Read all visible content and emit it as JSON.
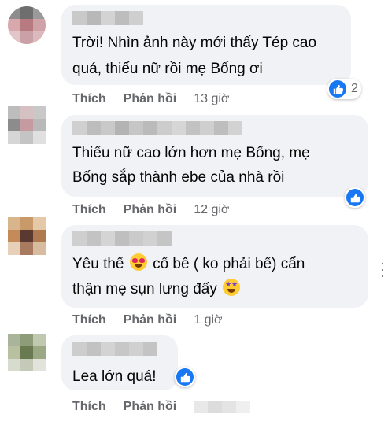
{
  "colors": {
    "like_blue": "#1877f2",
    "bubble_bg": "#f0f2f5",
    "text": "#050505",
    "muted": "#65676b"
  },
  "comments": [
    {
      "text_lines": [
        "Trời! Nhìn ảnh này mới thấy Tép cao",
        "quá, thiếu nữ rồi mẹ Bống ơi"
      ],
      "reaction": {
        "icon": "like-icon",
        "count": "2"
      },
      "actions": {
        "like": "Thích",
        "reply": "Phản hồi",
        "time": "13 giờ"
      }
    },
    {
      "text_lines": [
        "Thiếu nữ cao lớn hơn mẹ Bống, mẹ",
        "Bống sắp thành ebe của nhà rồi"
      ],
      "reaction": {
        "icon": "like-icon",
        "count": ""
      },
      "actions": {
        "like": "Thích",
        "reply": "Phản hồi",
        "time": "12 giờ"
      }
    },
    {
      "text_lines": [
        "Yêu thế",
        "cố bê ( ko phải bế) cẩn",
        "thận mẹ sụn lưng đấy"
      ],
      "emojis": [
        "heart-eyes-emoji",
        "star-struck-emoji"
      ],
      "actions": {
        "like": "Thích",
        "reply": "Phản hồi",
        "time": "1 giờ"
      }
    },
    {
      "text_lines": [
        "Lea lớn quá!"
      ],
      "reaction": {
        "icon": "like-icon",
        "count": ""
      },
      "actions": {
        "like": "Thích",
        "reply": "Phản hồi",
        "time": ""
      }
    }
  ]
}
